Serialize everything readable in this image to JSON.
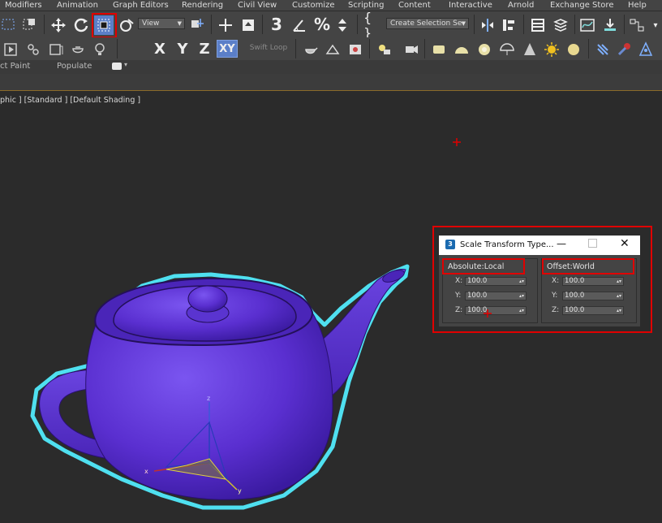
{
  "menu": [
    "Modifiers",
    "Animation",
    "Graph Editors",
    "Rendering",
    "Civil View",
    "Customize",
    "Scripting",
    "Content",
    "Interactive",
    "Arnold",
    "Exchange Store",
    "Help"
  ],
  "toolbar": {
    "view_dropdown": "View",
    "selection_set": "Create Selection Se",
    "axis_x": "X",
    "axis_y": "Y",
    "axis_z": "Z",
    "axis_xy": "XY",
    "swift_loop": "Swift Loop",
    "three_label": "3",
    "pct_label": "%"
  },
  "ribbon": {
    "tab1": "ct Paint",
    "tab2": "Populate"
  },
  "viewport": {
    "label": "phic ] [Standard ] [Default Shading ]",
    "gizmo": {
      "x": "x",
      "y": "y",
      "z": "z"
    }
  },
  "dialog": {
    "title": "Scale Transform Type...",
    "absolute": {
      "label": "Absolute:Local",
      "x": "100.0",
      "y": "100.0",
      "z": "100.0"
    },
    "offset": {
      "label": "Offset:World",
      "x": "100.0",
      "y": "100.0",
      "z": "100.0"
    },
    "labels": {
      "x": "X:",
      "y": "Y:",
      "z": "Z:"
    }
  },
  "colors": {
    "teapot": "#5a2fd0",
    "outline": "#4fe0f0",
    "highlight": "#e00000",
    "active_button": "#5b7fc8"
  }
}
